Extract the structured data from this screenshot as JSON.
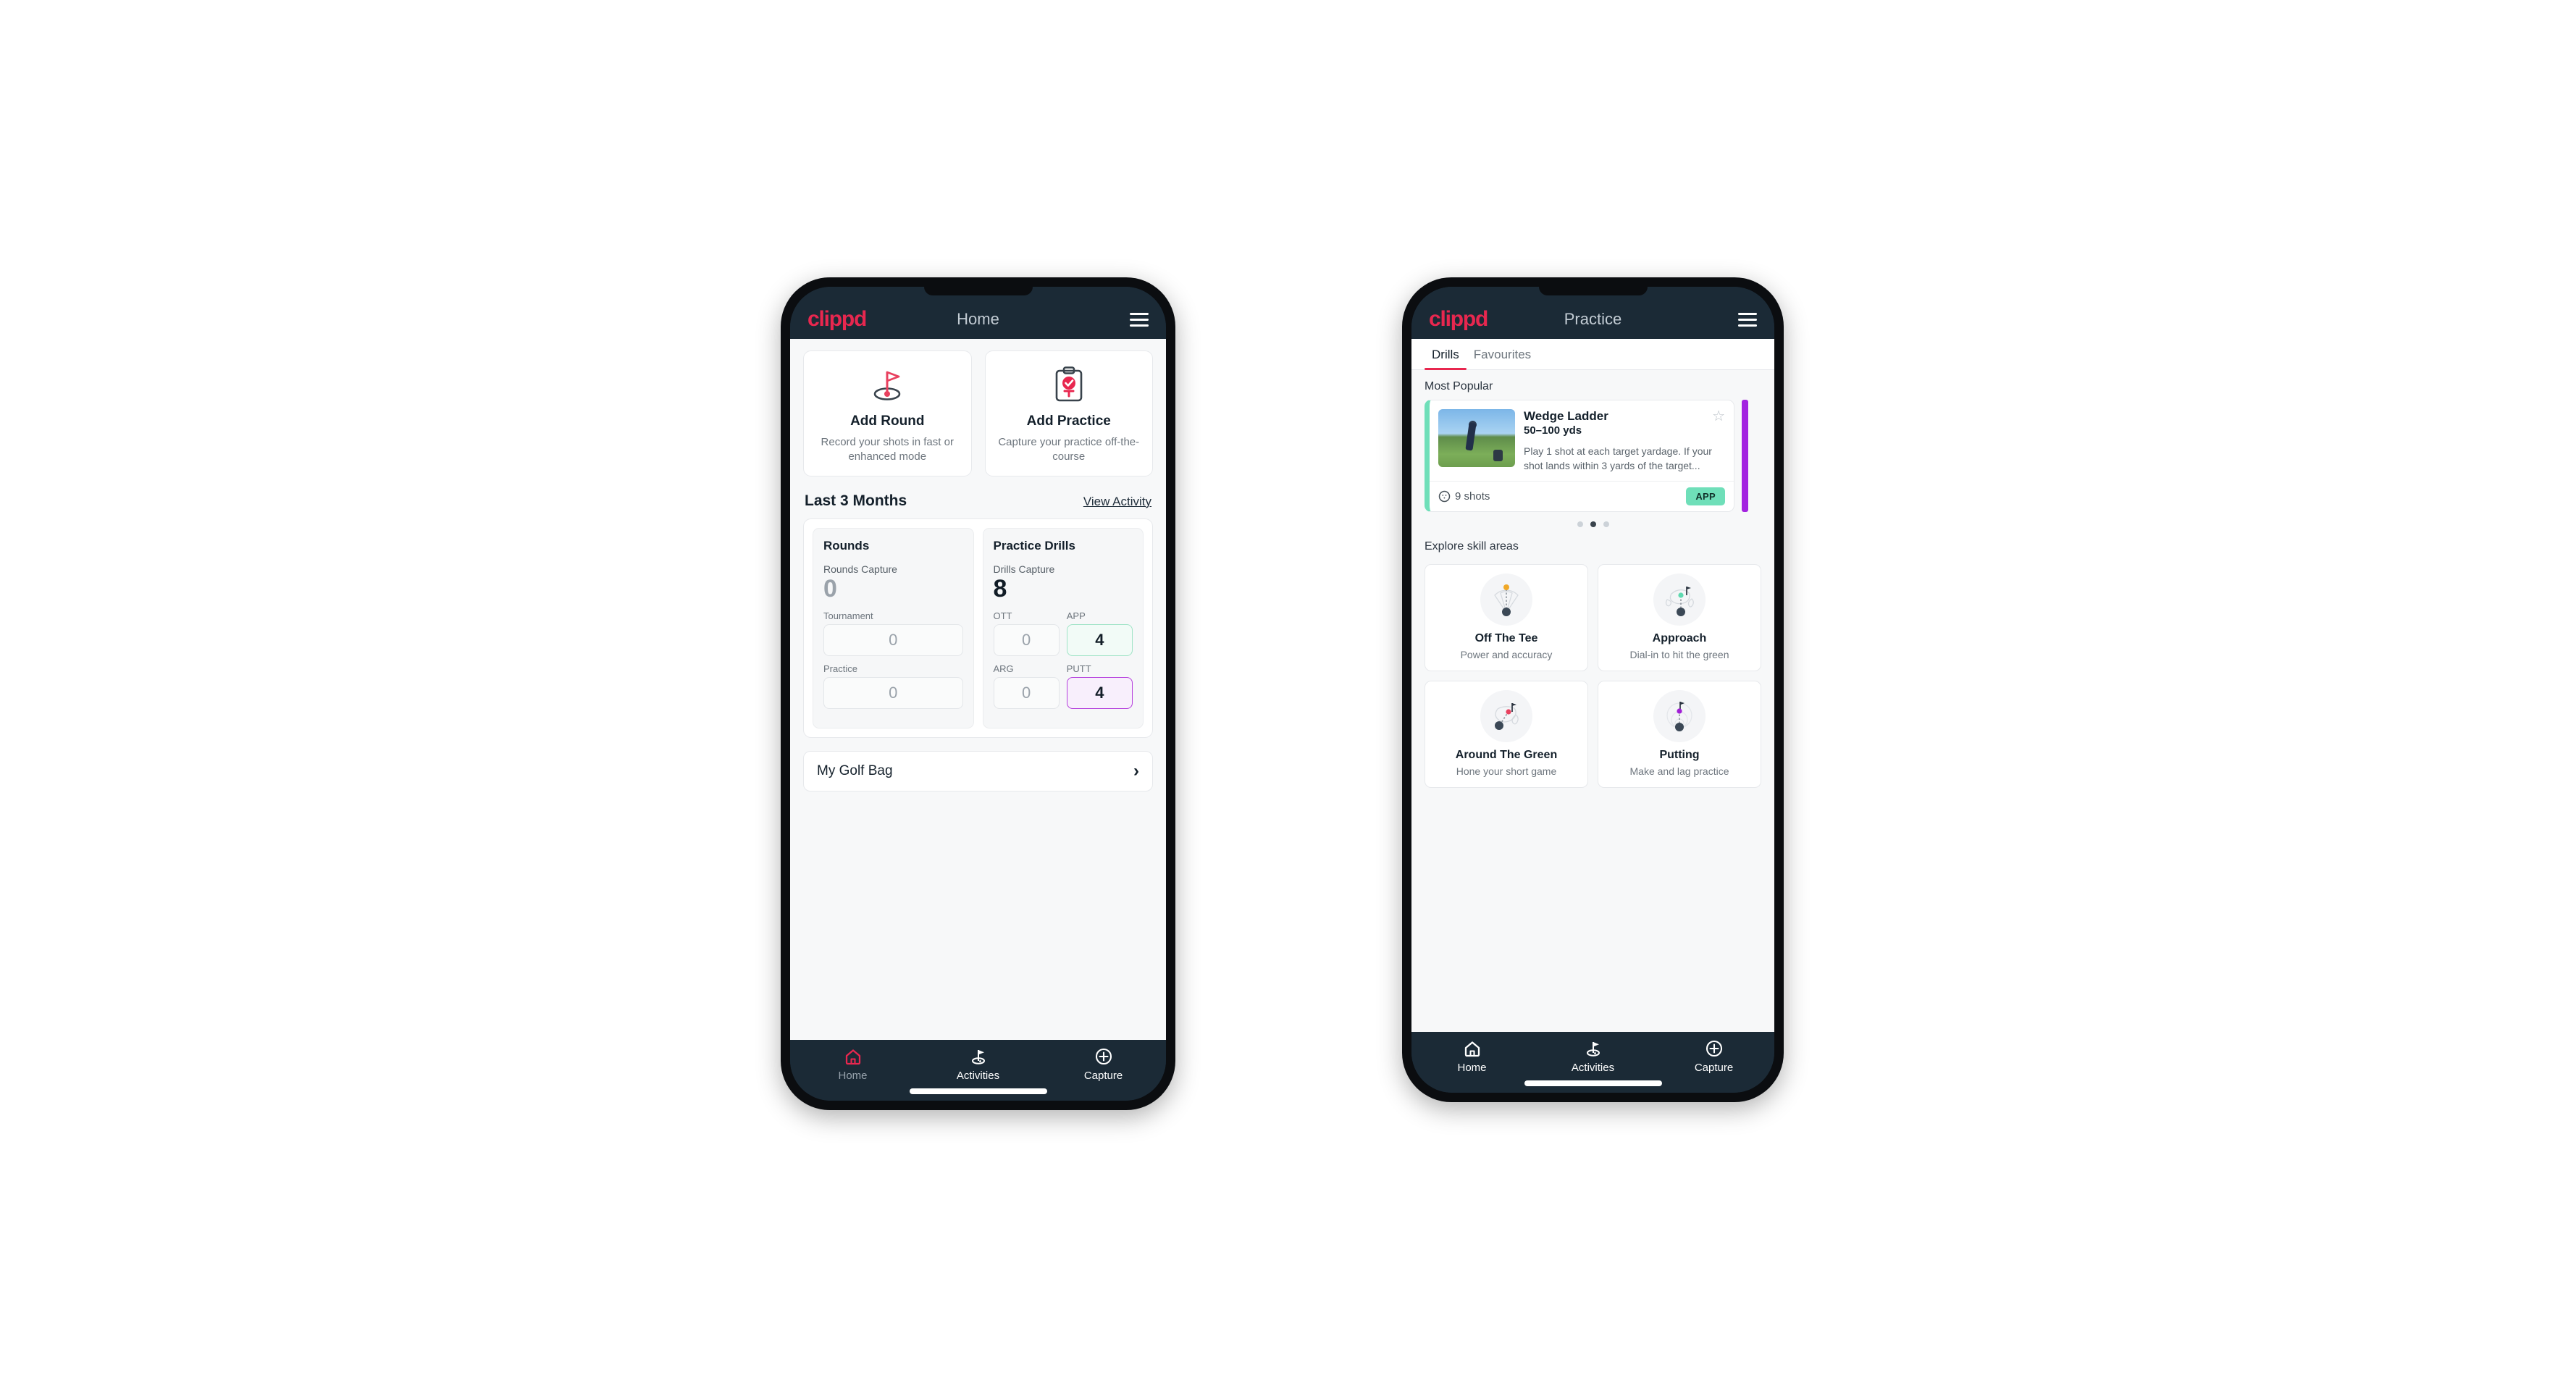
{
  "phone_home": {
    "appbar": {
      "logo": "clippd",
      "title": "Home",
      "menu_icon": "hamburger-icon"
    },
    "actions": [
      {
        "icon": "golf-flag-icon",
        "title": "Add Round",
        "subtitle": "Record your shots in fast or enhanced mode"
      },
      {
        "icon": "clipboard-check-icon",
        "title": "Add Practice",
        "subtitle": "Capture your practice off-the-course"
      }
    ],
    "section": {
      "title": "Last 3 Months",
      "link": "View Activity"
    },
    "rounds": {
      "title": "Rounds",
      "capture_label": "Rounds Capture",
      "capture_value": "0",
      "fields": [
        {
          "label": "Tournament",
          "value": "0",
          "state": "empty"
        },
        {
          "label": "Practice",
          "value": "0",
          "state": "empty"
        }
      ]
    },
    "drills": {
      "title": "Practice Drills",
      "capture_label": "Drills Capture",
      "capture_value": "8",
      "fields": [
        {
          "label": "OTT",
          "value": "0",
          "state": "empty"
        },
        {
          "label": "APP",
          "value": "4",
          "state": "green"
        },
        {
          "label": "ARG",
          "value": "0",
          "state": "empty"
        },
        {
          "label": "PUTT",
          "value": "4",
          "state": "purple"
        }
      ]
    },
    "golf_bag": {
      "label": "My Golf Bag",
      "chevron": "chevron-right-icon"
    },
    "nav": [
      {
        "icon": "home-icon",
        "label": "Home",
        "active": true
      },
      {
        "icon": "golf-flag-icon",
        "label": "Activities",
        "active": false
      },
      {
        "icon": "plus-circle-icon",
        "label": "Capture",
        "active": false
      }
    ]
  },
  "phone_practice": {
    "appbar": {
      "logo": "clippd",
      "title": "Practice",
      "menu_icon": "hamburger-icon"
    },
    "tabs": [
      {
        "label": "Drills",
        "active": true
      },
      {
        "label": "Favourites",
        "active": false
      }
    ],
    "most_popular_label": "Most Popular",
    "drill": {
      "name": "Wedge Ladder",
      "yardage": "50–100 yds",
      "description": "Play 1 shot at each target yardage. If your shot lands within 3 yards of the target...",
      "shots": "9 shots",
      "shots_icon": "golf-ball-icon",
      "badge": "APP",
      "favourite_icon": "star-outline-icon",
      "accent_color": "#6fdfb9",
      "next_accent_color": "#a323e0"
    },
    "carousel_dots": {
      "count": 3,
      "active_index": 1
    },
    "skill_header": "Explore skill areas",
    "skills": [
      {
        "icon": "tee-shot-dispersion-icon",
        "title": "Off The Tee",
        "subtitle": "Power and accuracy",
        "dot_color": "#f0a828"
      },
      {
        "icon": "approach-green-icon",
        "title": "Approach",
        "subtitle": "Dial-in to hit the green",
        "dot_color": "#5fd9b0"
      },
      {
        "icon": "chip-green-icon",
        "title": "Around The Green",
        "subtitle": "Hone your short game",
        "dot_color": "#e8415f"
      },
      {
        "icon": "putting-rings-icon",
        "title": "Putting",
        "subtitle": "Make and lag practice",
        "dot_color": "#a11fd6"
      }
    ],
    "nav": [
      {
        "icon": "home-icon",
        "label": "Home",
        "active": false
      },
      {
        "icon": "golf-flag-icon",
        "label": "Activities",
        "active": false
      },
      {
        "icon": "plus-circle-icon",
        "label": "Capture",
        "active": false
      }
    ]
  },
  "theme": {
    "brand_pink": "#e8274f",
    "dark_navy": "#1b2a36",
    "green_accent": "#6fdfb9",
    "purple_accent": "#a323e0",
    "page_bg": "#f7f8f9"
  }
}
